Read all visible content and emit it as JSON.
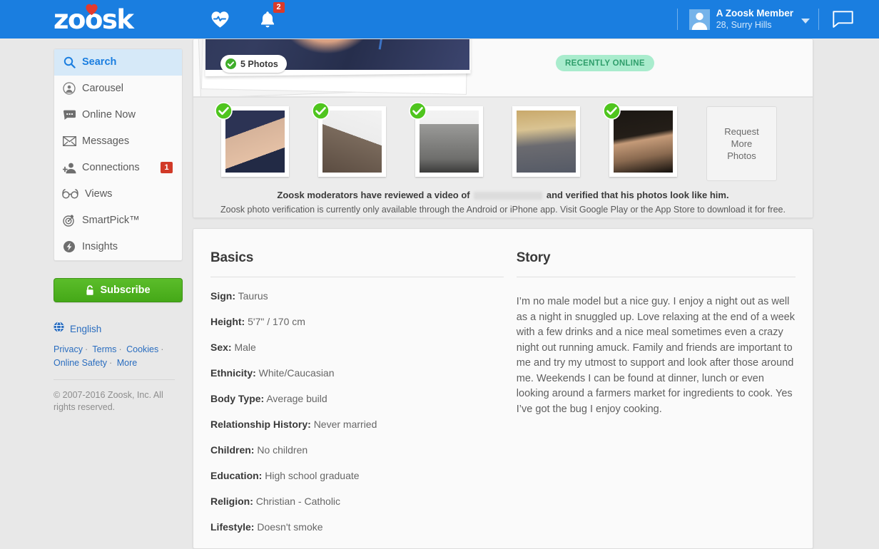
{
  "brand": {
    "name": "zoosk",
    "accent": "#1a7ee0",
    "green": "#45a818",
    "red": "#d13a28"
  },
  "header": {
    "logo_text": "zoosk",
    "matches_icon": "heart-pulse-icon",
    "notifications_icon": "bell-icon",
    "notifications_count": "2",
    "user": {
      "name": "A Zoosk Member",
      "subtitle": "28, Surry Hills"
    },
    "chat_icon": "chat-bubble-icon"
  },
  "sidebar": {
    "items": [
      {
        "label": "Search",
        "icon": "magnifier-icon",
        "active": true,
        "badge": ""
      },
      {
        "label": "Carousel",
        "icon": "carousel-icon",
        "active": false,
        "badge": ""
      },
      {
        "label": "Online Now",
        "icon": "chat-dots-icon",
        "active": false,
        "badge": ""
      },
      {
        "label": "Messages",
        "icon": "envelope-icon",
        "active": false,
        "badge": ""
      },
      {
        "label": "Connections",
        "icon": "add-person-icon",
        "active": false,
        "badge": "1"
      },
      {
        "label": "Views",
        "icon": "glasses-icon",
        "active": false,
        "badge": ""
      },
      {
        "label": "SmartPick™",
        "icon": "target-icon",
        "active": false,
        "badge": ""
      },
      {
        "label": "Insights",
        "icon": "lightning-circle-icon",
        "active": false,
        "badge": ""
      }
    ],
    "subscribe_label": "Subscribe",
    "subscribe_icon": "lock-icon",
    "language_label": "English",
    "language_icon": "globe-icon",
    "footer_links": [
      "Privacy",
      "Terms",
      "Cookies",
      "Online Safety",
      "More"
    ],
    "copyright": "© 2007-2016 Zoosk, Inc. All rights reserved."
  },
  "profile": {
    "photo_count_label": "5 Photos",
    "photo_count_icon": "green-check-icon",
    "online_status": "RECENTLY ONLINE",
    "thumbnails": [
      {
        "verified": true,
        "alt": "man in dark cap"
      },
      {
        "verified": true,
        "alt": "man seated indoors"
      },
      {
        "verified": true,
        "alt": "man with grey hair"
      },
      {
        "verified": false,
        "alt": "person in kitchen"
      },
      {
        "verified": true,
        "alt": "man in dark room"
      }
    ],
    "request_more_photos": "Request\nMore\nPhotos",
    "request_more_photos_lines": [
      "Request",
      "More",
      "Photos"
    ],
    "verification_line_a": "Zoosk moderators have reviewed a video of",
    "verification_name_redacted": true,
    "verification_line_b": "and verified that his photos look like him.",
    "verification_note": "Zoosk photo verification is currently only available through the Android or iPhone app. Visit Google Play or the App Store to download it for free."
  },
  "basics": {
    "title": "Basics",
    "facts": [
      {
        "label": "Sign:",
        "value": "Taurus"
      },
      {
        "label": "Height:",
        "value": "5'7\" / 170 cm"
      },
      {
        "label": "Sex:",
        "value": "Male"
      },
      {
        "label": "Ethnicity:",
        "value": "White/Caucasian"
      },
      {
        "label": "Body Type:",
        "value": "Average build"
      },
      {
        "label": "Relationship History:",
        "value": "Never married"
      },
      {
        "label": "Children:",
        "value": "No children"
      },
      {
        "label": "Education:",
        "value": "High school graduate"
      },
      {
        "label": "Religion:",
        "value": "Christian - Catholic"
      },
      {
        "label": "Lifestyle:",
        "value": "Doesn't smoke"
      }
    ]
  },
  "story": {
    "title": "Story",
    "text": "I’m no male model but a nice guy. I enjoy a night out as well as a night in snuggled up. Love relaxing at the end of a week with a few drinks and a nice meal sometimes even a crazy night out running amuck. Family and friends are important to me and try my utmost to support and look after those around me. Weekends I can be found at dinner, lunch or even looking around a farmers market for ingredients to cook. Yes I’ve got the bug I enjoy cooking."
  }
}
